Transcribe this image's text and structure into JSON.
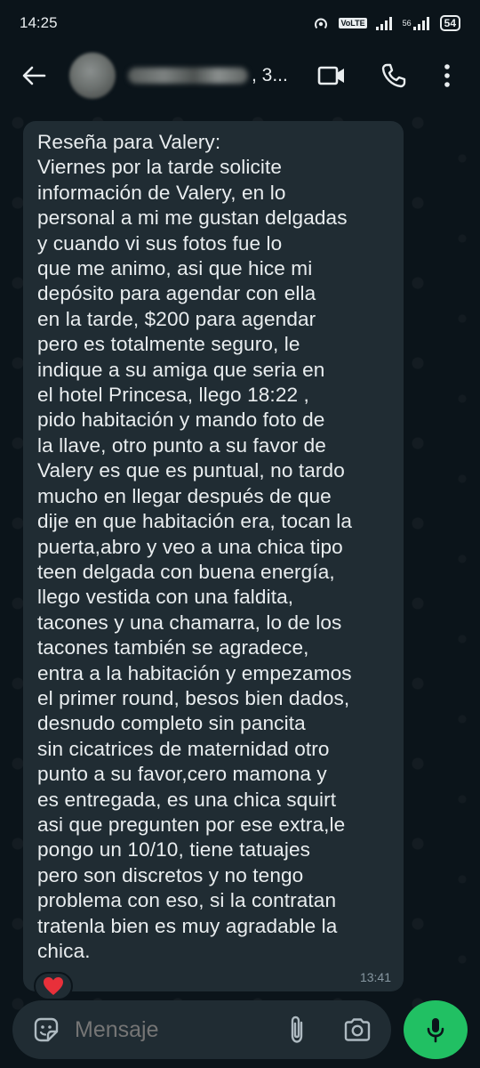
{
  "status_bar": {
    "time": "14:25",
    "signal_label": "56",
    "volte_label": "VoLTE",
    "battery": "54"
  },
  "header": {
    "contact_name_visible": ", 3...",
    "icons": [
      "back-arrow-icon",
      "video-call-icon",
      "phone-icon",
      "more-options-icon"
    ]
  },
  "message": {
    "text": "Reseña para Valery:\nViernes por la tarde solicite\ninformación de Valery, en lo\npersonal a mi me gustan delgadas\ny cuando vi sus fotos fue lo\nque me animo, asi que hice mi\ndepósito para agendar con ella\nen la tarde, $200 para agendar\npero es totalmente seguro, le\nindique a su amiga que seria en\nel hotel Princesa, llego 18:22 ,\n pido habitación y mando foto de\nla llave, otro punto a su favor de\nValery es que es puntual, no tardo\nmucho en llegar después de que\ndije en que habitación era, tocan la\npuerta,abro y veo a una chica tipo\nteen delgada con buena energía,\nllego vestida con una faldita,\ntacones y una chamarra, lo de los\ntacones también se agradece,\nentra a la habitación y empezamos\nel primer round, besos bien dados,\ndesnudo completo sin pancita\nsin cicatrices de maternidad otro\npunto a su favor,cero mamona y\nes entregada, es una chica squirt\nasi que pregunten por ese extra,le\npongo un 10/10, tiene tatuajes\npero son discretos y no tengo\nproblema con eso, si la contratan\ntratenla bien es muy agradable la\nchica.",
    "time": "13:41",
    "reaction": "❤"
  },
  "input": {
    "placeholder": "Mensaje"
  },
  "colors": {
    "background": "#0b141a",
    "bubble": "#202c33",
    "accent_green": "#21c063",
    "secondary_text": "#8696a0"
  }
}
